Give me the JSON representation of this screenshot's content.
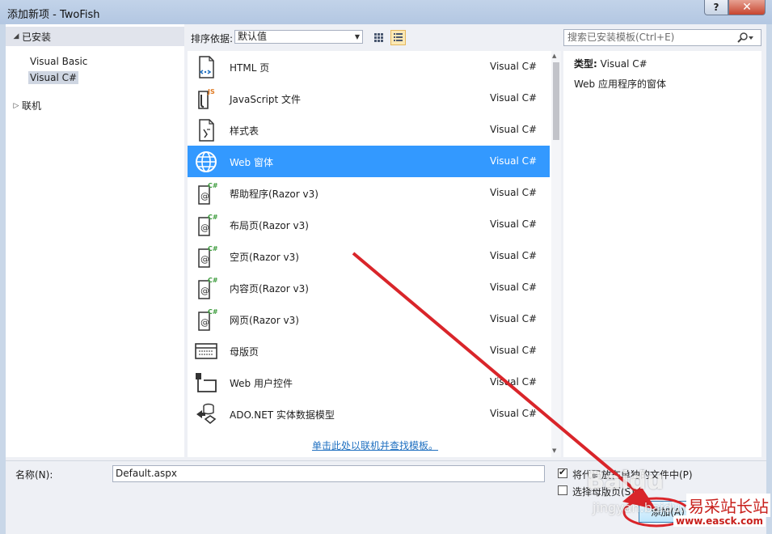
{
  "window": {
    "title": "添加新项 - TwoFish",
    "help_label": "?",
    "close_label": "✕"
  },
  "tree": {
    "installed_label": "已安装",
    "items": [
      {
        "label": "Visual Basic",
        "selected": false
      },
      {
        "label": "Visual C#",
        "selected": true
      }
    ],
    "online_label": "联机"
  },
  "toolbar": {
    "sort_label": "排序依据:",
    "sort_value": "默认值"
  },
  "search": {
    "placeholder": "搜索已安装模板(Ctrl+E)"
  },
  "templates": [
    {
      "name": "HTML 页",
      "lang": "Visual C#",
      "icon": "html-page-icon"
    },
    {
      "name": "JavaScript 文件",
      "lang": "Visual C#",
      "icon": "javascript-file-icon"
    },
    {
      "name": "样式表",
      "lang": "Visual C#",
      "icon": "stylesheet-icon"
    },
    {
      "name": "Web 窗体",
      "lang": "Visual C#",
      "icon": "web-form-globe-icon",
      "selected": true
    },
    {
      "name": "帮助程序(Razor v3)",
      "lang": "Visual C#",
      "icon": "razor-file-icon"
    },
    {
      "name": "布局页(Razor v3)",
      "lang": "Visual C#",
      "icon": "razor-file-icon"
    },
    {
      "name": "空页(Razor v3)",
      "lang": "Visual C#",
      "icon": "razor-file-icon"
    },
    {
      "name": "内容页(Razor v3)",
      "lang": "Visual C#",
      "icon": "razor-file-icon"
    },
    {
      "name": "网页(Razor v3)",
      "lang": "Visual C#",
      "icon": "razor-file-icon"
    },
    {
      "name": "母版页",
      "lang": "Visual C#",
      "icon": "master-page-icon"
    },
    {
      "name": "Web 用户控件",
      "lang": "Visual C#",
      "icon": "user-control-icon"
    },
    {
      "name": "ADO.NET 实体数据模型",
      "lang": "Visual C#",
      "icon": "entity-model-icon"
    }
  ],
  "online_link": "单击此处以联机并查找模板。",
  "details": {
    "type_label": "类型:",
    "type_value": "Visual C#",
    "description": "Web 应用程序的窗体"
  },
  "bottom": {
    "name_label": "名称(N):",
    "name_value": "Default.aspx",
    "chk1_label": "将代码放在单独的文件中(P)",
    "chk1_checked": true,
    "chk2_label": "选择母版页(S)",
    "chk2_checked": false,
    "add_label": "添加(A)"
  },
  "watermark": {
    "site": "易采站长站",
    "url": "www.easck.com",
    "baidu": "Baidu",
    "jingyan": "jingyan.baidu.com"
  },
  "colors": {
    "selection": "#3399ff",
    "annotation_red": "#d9252a",
    "link": "#1e6fc0"
  }
}
